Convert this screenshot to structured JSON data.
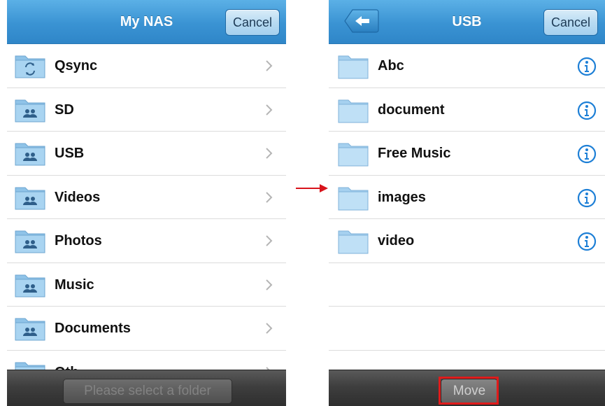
{
  "left": {
    "title": "My NAS",
    "cancel_label": "Cancel",
    "items": [
      {
        "label": "Qsync",
        "icon": "sync-folder-icon"
      },
      {
        "label": "SD",
        "icon": "shared-folder-icon"
      },
      {
        "label": "USB",
        "icon": "shared-folder-icon"
      },
      {
        "label": "Videos",
        "icon": "shared-folder-icon"
      },
      {
        "label": "Photos",
        "icon": "shared-folder-icon"
      },
      {
        "label": "Music",
        "icon": "shared-folder-icon"
      },
      {
        "label": "Documents",
        "icon": "shared-folder-icon"
      },
      {
        "label": "Oth",
        "icon": "shared-folder-icon"
      }
    ],
    "bottom_button": "Please select a folder"
  },
  "right": {
    "title": "USB",
    "back_icon": "back-arrow-icon",
    "cancel_label": "Cancel",
    "items": [
      {
        "label": "Abc",
        "icon": "folder-icon",
        "action_icon": "info-icon"
      },
      {
        "label": "document",
        "icon": "folder-icon",
        "action_icon": "info-icon"
      },
      {
        "label": "Free Music",
        "icon": "folder-icon",
        "action_icon": "info-icon"
      },
      {
        "label": "images",
        "icon": "folder-icon",
        "action_icon": "info-icon"
      },
      {
        "label": "video",
        "icon": "folder-icon",
        "action_icon": "info-icon"
      }
    ],
    "move_label": "Move"
  },
  "colors": {
    "header_blue": "#3a93d3",
    "highlight_red": "#e01b1b",
    "arrow_red": "#d8141c",
    "info_blue": "#1d7fd6"
  }
}
